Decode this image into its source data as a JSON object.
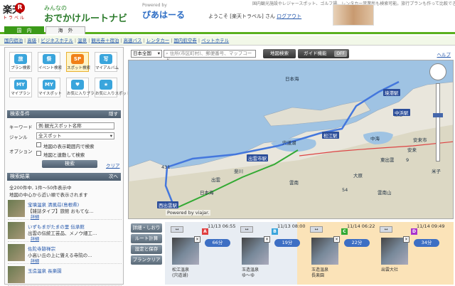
{
  "header": {
    "logo_main": "楽天",
    "logo_mark": "R",
    "logo_sub": "トラベル",
    "site_sub": "みんなの",
    "site_title": "おでかけルートナビ",
    "powered_by": "Powered by",
    "partner": "ぴあはーる",
    "welcome_prefix": "ようこそ",
    "user_name": "[楽天トラベル]",
    "welcome_suffix": "さん",
    "logout": "ログアウト",
    "tagline": "国内観光施設やレジャースポット、ゴルフ場、レンタカー営業所も検索可能。旅行プランも作って比較できる!"
  },
  "tabs": {
    "domestic": "国　内",
    "overseas": "海　外"
  },
  "links": [
    "国内宿泊",
    "高級",
    "ビジネスホテル",
    "温泉",
    "観光券＋宿泊",
    "高速バス",
    "レンタカー",
    "国内航空券",
    "ペットホテル"
  ],
  "sidebar": {
    "icons": [
      {
        "label": "プラン検索",
        "glyph": "旅",
        "icon": "plan-search-icon"
      },
      {
        "label": "イベント検索",
        "glyph": "祭",
        "icon": "event-search-icon"
      },
      {
        "label": "スポット検索",
        "glyph": "SP",
        "icon": "spot-search-icon"
      },
      {
        "label": "マイアルバム",
        "glyph": "写",
        "icon": "my-album-icon"
      },
      {
        "label": "マイプラン",
        "glyph": "MY",
        "icon": "my-plan-icon"
      },
      {
        "label": "マイスポット",
        "glyph": "MY",
        "icon": "my-spot-icon"
      },
      {
        "label": "お気に入りプラン",
        "glyph": "♥",
        "icon": "favorite-plan-icon"
      },
      {
        "label": "お気に入りスポット",
        "glyph": "★",
        "icon": "favorite-spot-icon"
      }
    ],
    "search": {
      "title": "検索条件",
      "hide": "隠す",
      "keyword_label": "キーワード",
      "keyword_value": "例:観光スポット名称",
      "genre_label": "ジャンル",
      "genre_value": "全スポット",
      "option_label": "オプション",
      "option_1": "地図の表示範囲内で検索",
      "option_2": "地図と連動して検索",
      "search_btn": "検索",
      "clear": "クリア"
    },
    "results": {
      "title": "検索結果",
      "next": "次へ",
      "count": "全200件中, 1件～50件表示中",
      "order": "地図の中心から近い順で表示されます",
      "items": [
        {
          "name": "宝墳温泉 清風荘(島根県)",
          "desc": "【雑誌タイプ】旅館 おもてな…",
          "detail": "詳細"
        },
        {
          "name": "いずもまがたまの里 伝承館",
          "desc": "出雲の伝統工芸品、メノウ細工…",
          "detail": "詳細"
        },
        {
          "name": "佐陀寺跡禅宗",
          "desc": "小高い丘の上に聳える寺院の…",
          "detail": "詳細"
        },
        {
          "name": "玉造温泉 長楽園",
          "desc": "",
          "detail": ""
        }
      ]
    }
  },
  "toolbar": {
    "region": "日本全国",
    "placeholder": "住所(市区町村)、郵便番号、マップコード",
    "map_search": "地図検索",
    "guide": "ガイド機能",
    "guide_state": "OFF",
    "help": "ヘルプ"
  },
  "map": {
    "sea_labels": [
      "日本海",
      "日本海",
      "宍道湖",
      "中海"
    ],
    "land_labels": [
      "境港",
      "米子",
      "安来",
      "出雲",
      "雲南",
      "斐川",
      "大原",
      "雲南山"
    ],
    "stations": [
      "境港駅",
      "中浜駅",
      "松江駅",
      "出雲市駅",
      "西出雲駅"
    ],
    "road_labels": [
      "431",
      "9",
      "54",
      "安来市",
      "東出雲"
    ],
    "powered": "Powered by viajar."
  },
  "bottom": {
    "buttons": [
      "詳細・しおり",
      "ルート計算",
      "設定と保存",
      "プランクリア"
    ],
    "durations": [
      "11/13 06:55",
      "11/13 08:00",
      "11/14 06:22",
      "11/14 09:49"
    ],
    "legs": [
      "66分",
      "19分",
      "22分",
      "34分"
    ],
    "spots": [
      {
        "label": "松江温泉",
        "sub": "(宍道湖)"
      },
      {
        "label": "玉造温泉",
        "sub": "ゆ～ゆ"
      },
      {
        "label": "玉造温泉",
        "sub": "長楽園"
      },
      {
        "label": "出雲大社",
        "sub": ""
      }
    ],
    "pins": [
      "A",
      "B",
      "C",
      "D"
    ]
  }
}
